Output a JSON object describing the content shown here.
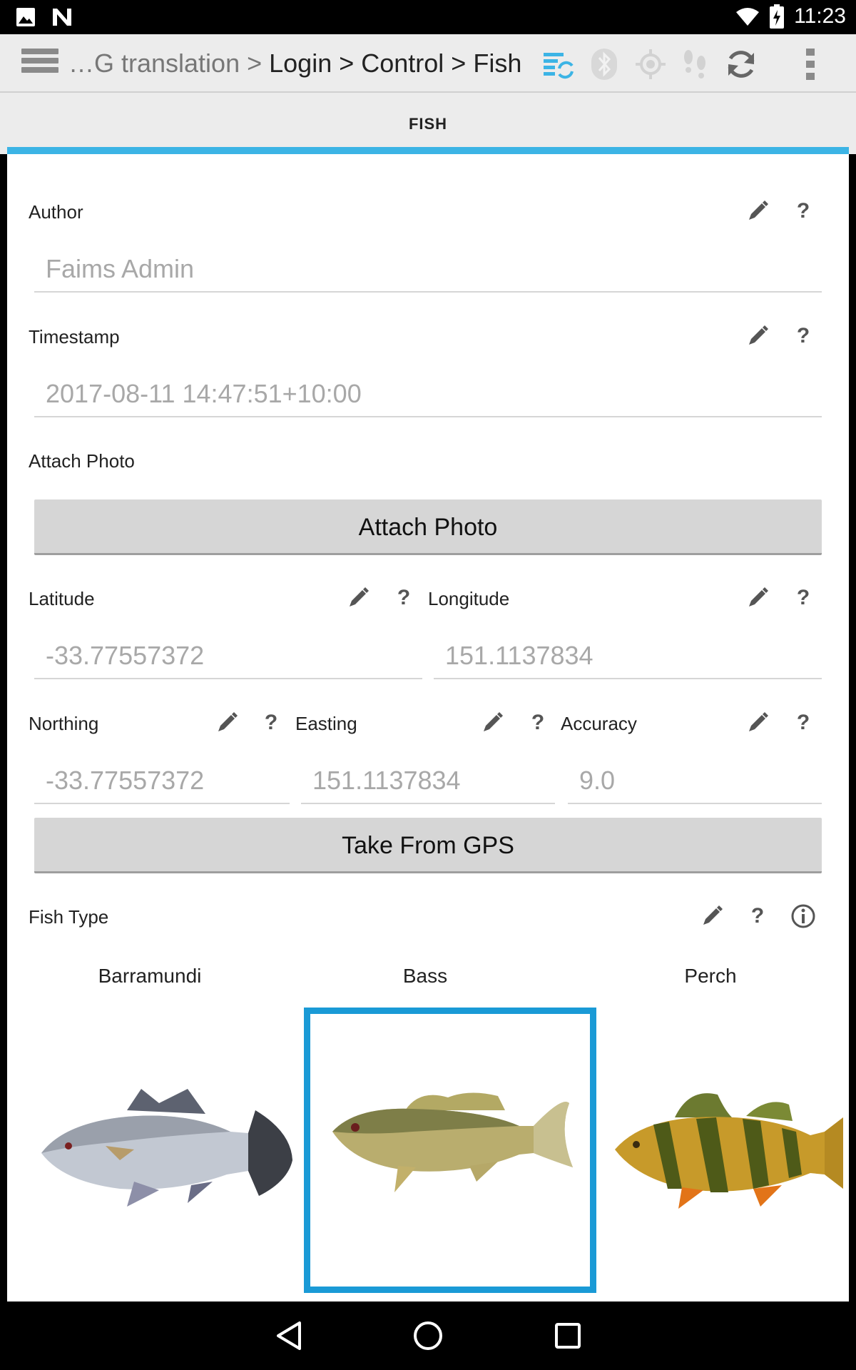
{
  "status_bar": {
    "time": "11:23",
    "icons": [
      "image-icon",
      "n-icon",
      "wifi-icon",
      "battery-icon"
    ]
  },
  "action_bar": {
    "breadcrumb_prefix": "…G translation >",
    "breadcrumb_path": "Login > Control > Fish",
    "icons": [
      "sync-status-icon",
      "bluetooth-icon",
      "gps-icon",
      "tracking-icon",
      "refresh-icon",
      "overflow-menu-icon"
    ],
    "accent": "#3cb4e5"
  },
  "tab": {
    "label": "FISH"
  },
  "form": {
    "author": {
      "label": "Author",
      "value": "Faims Admin"
    },
    "timestamp": {
      "label": "Timestamp",
      "value": "2017-08-11 14:47:51+10:00"
    },
    "attach_photo": {
      "label": "Attach Photo",
      "button": "Attach Photo"
    },
    "latitude": {
      "label": "Latitude",
      "value": "-33.77557372"
    },
    "longitude": {
      "label": "Longitude",
      "value": "151.1137834"
    },
    "northing": {
      "label": "Northing",
      "value": "-33.77557372"
    },
    "easting": {
      "label": "Easting",
      "value": "151.1137834"
    },
    "accuracy": {
      "label": "Accuracy",
      "value": "9.0"
    },
    "gps_button": "Take From GPS",
    "fish_type": {
      "label": "Fish Type",
      "options": [
        {
          "label": "Barramundi",
          "selected": false
        },
        {
          "label": "Bass",
          "selected": true
        },
        {
          "label": "Perch",
          "selected": false
        }
      ]
    }
  },
  "help_symbol": "?",
  "selection_color": "#1a9ad6"
}
